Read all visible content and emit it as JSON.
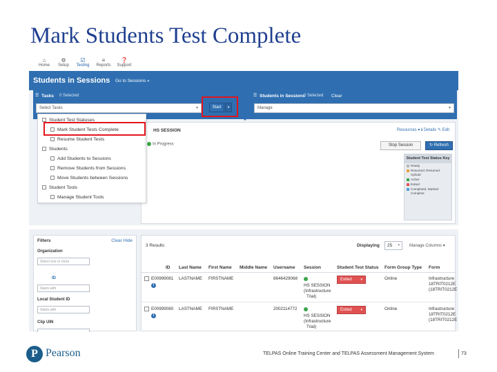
{
  "slide": {
    "title": "Mark Students Test Complete"
  },
  "nav": [
    {
      "label": "Home",
      "icon": "home-icon",
      "glyph": "⌂"
    },
    {
      "label": "Setup",
      "icon": "gear-icon",
      "glyph": "⚙"
    },
    {
      "label": "Testing",
      "icon": "check-icon",
      "glyph": "☑"
    },
    {
      "label": "Reports",
      "icon": "list-icon",
      "glyph": "≡"
    },
    {
      "label": "Support",
      "icon": "help-icon",
      "glyph": "❓"
    }
  ],
  "panel": {
    "title": "Students in Sessions",
    "goto_link": "Go to Sessions »",
    "tasks": {
      "title": "Tasks",
      "selected": "0 Selected",
      "select_value": "Select Tasks",
      "start": "Start"
    },
    "students_bar": {
      "title": "Students in Sessions",
      "selected": "0 Selected",
      "clear": "Clear",
      "select_value": "Manage"
    }
  },
  "dropdown": {
    "items": [
      {
        "label": "Student Test Statuses",
        "indent": 0
      },
      {
        "label": "Mark Student Tests Complete",
        "indent": 1
      },
      {
        "label": "Resume Student Tests",
        "indent": 1
      },
      {
        "label": "Students",
        "indent": 0
      },
      {
        "label": "Add Students to Sessions",
        "indent": 1
      },
      {
        "label": "Remove Students from Sessions",
        "indent": 1
      },
      {
        "label": "Move Students between Sessions",
        "indent": 1
      },
      {
        "label": "Student Tools",
        "indent": 0
      },
      {
        "label": "Manage Student Tools",
        "indent": 1
      }
    ]
  },
  "session_card": {
    "title": "HS SESSION",
    "links": "Resources ▾   ℹ Details   ✎ Edit",
    "status": "In Progress",
    "stop_session": "Stop Session",
    "refresh": "↻ Refresh",
    "key_title": "Student Test Status Key",
    "key": [
      {
        "label": "Ready",
        "color": "#b8b8b8"
      },
      {
        "label": "Resumed, Resumed Upload",
        "color": "#e8a33d"
      },
      {
        "label": "Active",
        "color": "#3aa64a"
      },
      {
        "label": "Exited",
        "color": "#e05252"
      },
      {
        "label": "Completed, Marked Complete",
        "color": "#4a9fd8"
      }
    ]
  },
  "filters": {
    "title": "Filters",
    "links": "Clear  Hide",
    "organization_label": "Organization",
    "organization_placeholder": "Select one or more",
    "id_label": "ID",
    "local_id_label": "Local Student ID",
    "local_id_placeholder": "Starts with",
    "clip_uin_label": "Clip UIN",
    "starts_with": "Starts with"
  },
  "results": {
    "count": "3 Results",
    "displaying_label": "Displaying",
    "displaying_value": "25",
    "manage_columns": "Manage Columns ▾",
    "headers": [
      "ID",
      "Last Name",
      "First Name",
      "Middle Name",
      "Username",
      "Session",
      "Student Test Status",
      "Form Group Type",
      "Form"
    ],
    "rows": [
      {
        "id": "E00999081",
        "last": "LASTNAME",
        "first": "FIRSTNAME",
        "middle": "",
        "username": "8646429068",
        "session": [
          "HS SESSION",
          "(Infrastructure",
          "Trial)"
        ],
        "status": "Exited",
        "form_group": "Online",
        "form": [
          "Infrastructure",
          "18TRIT0212E",
          "(18TRIT0212E"
        ]
      },
      {
        "id": "E00999080",
        "last": "LASTNAME",
        "first": "FIRSTNAME",
        "middle": "",
        "username": "2002114772",
        "session": [
          "HS SESSION",
          "(Infrastructure",
          "Trial)"
        ],
        "status": "Exited",
        "form_group": "Online",
        "form": [
          "Infrastructure",
          "18TRIT0212E",
          "(18TRIT0212E"
        ]
      }
    ]
  },
  "footer": {
    "logo_letter": "P",
    "logo_text": "Pearson",
    "text": "TELPAS Online Training Center and TELPAS Assessment Management System",
    "page": "73"
  }
}
